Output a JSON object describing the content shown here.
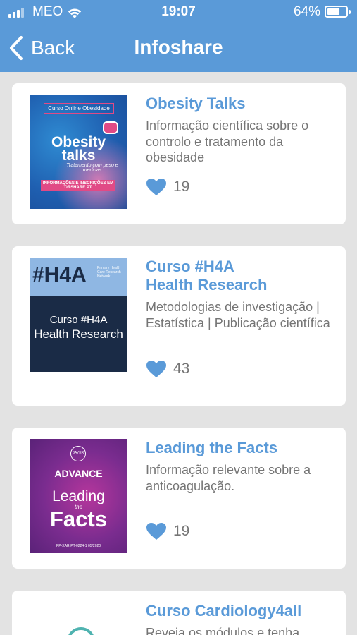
{
  "status_bar": {
    "carrier": "MEO",
    "time": "19:07",
    "battery": "64%"
  },
  "nav": {
    "back_label": "Back",
    "title": "Infoshare"
  },
  "items": [
    {
      "title": "Obesity Talks",
      "description": "Informação científica sobre o controlo e tratamento da obesidade",
      "likes": "19",
      "thumb": {
        "banner": "Curso Online Obesidade",
        "line1": "Obesity",
        "line2": "talks",
        "subtitle": "Tratamento com peso e medidas",
        "cta": "INFORMAÇÕES E INSCRIÇÕES EM DRSHARE.PT"
      }
    },
    {
      "title": "Curso #H4A\nHealth Research",
      "description": "Metodologias de investigação | Estatística | Publicação científica",
      "likes": "43",
      "thumb": {
        "logo": "#H4A",
        "logo_sub": "Primary Health Care Research Network",
        "line1": "Curso #H4A",
        "line2": "Health Research"
      }
    },
    {
      "title": "Leading the Facts",
      "description": "Informação relevante sobre a anticoagulação.",
      "likes": "19",
      "thumb": {
        "brand": "BAYER",
        "line1": "ADVANCE",
        "line2": "Leading",
        "line3": "the",
        "line4": "Facts",
        "code": "PP-XAR-PT-0224-1 05/2020"
      }
    },
    {
      "title": "Curso Cardiology4all",
      "description": "Reveja os módulos e tenha"
    }
  ],
  "colors": {
    "accent": "#5a9ad8",
    "background": "#e3e3e3",
    "text_muted": "#757575"
  }
}
